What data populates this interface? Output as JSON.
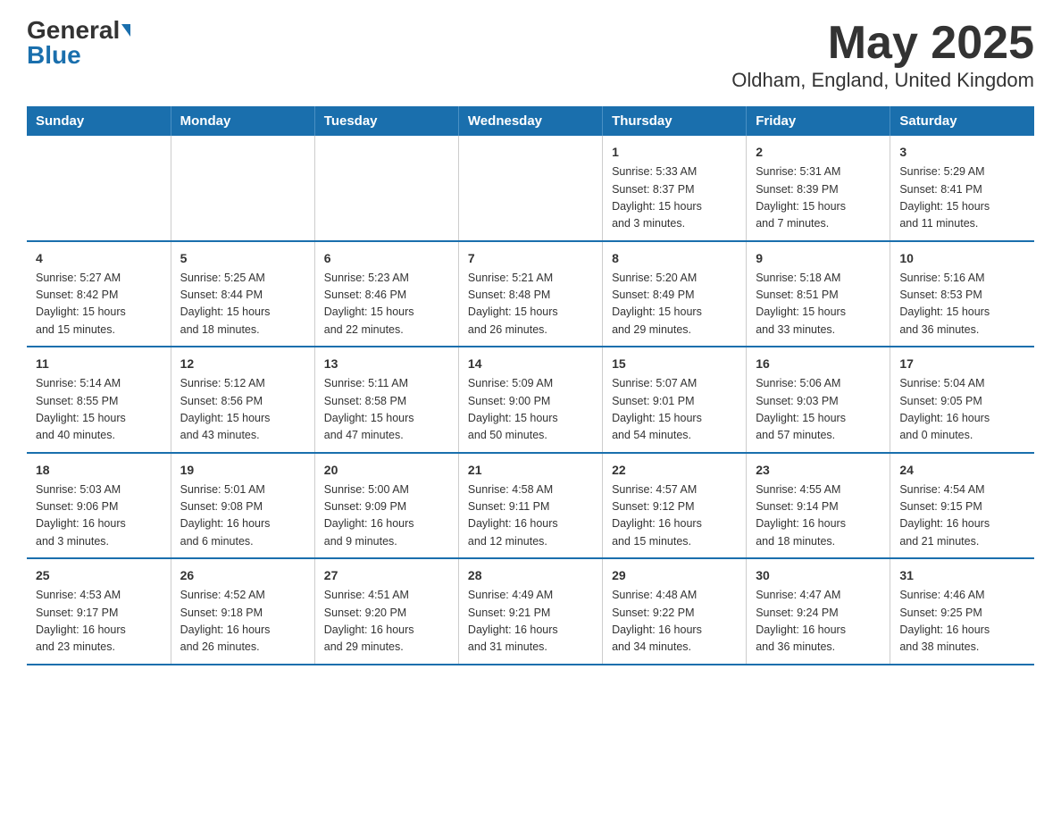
{
  "header": {
    "logo_general": "General",
    "logo_blue": "Blue",
    "title": "May 2025",
    "subtitle": "Oldham, England, United Kingdom"
  },
  "days_of_week": [
    "Sunday",
    "Monday",
    "Tuesday",
    "Wednesday",
    "Thursday",
    "Friday",
    "Saturday"
  ],
  "weeks": [
    [
      {
        "day": "",
        "info": ""
      },
      {
        "day": "",
        "info": ""
      },
      {
        "day": "",
        "info": ""
      },
      {
        "day": "",
        "info": ""
      },
      {
        "day": "1",
        "info": "Sunrise: 5:33 AM\nSunset: 8:37 PM\nDaylight: 15 hours\nand 3 minutes."
      },
      {
        "day": "2",
        "info": "Sunrise: 5:31 AM\nSunset: 8:39 PM\nDaylight: 15 hours\nand 7 minutes."
      },
      {
        "day": "3",
        "info": "Sunrise: 5:29 AM\nSunset: 8:41 PM\nDaylight: 15 hours\nand 11 minutes."
      }
    ],
    [
      {
        "day": "4",
        "info": "Sunrise: 5:27 AM\nSunset: 8:42 PM\nDaylight: 15 hours\nand 15 minutes."
      },
      {
        "day": "5",
        "info": "Sunrise: 5:25 AM\nSunset: 8:44 PM\nDaylight: 15 hours\nand 18 minutes."
      },
      {
        "day": "6",
        "info": "Sunrise: 5:23 AM\nSunset: 8:46 PM\nDaylight: 15 hours\nand 22 minutes."
      },
      {
        "day": "7",
        "info": "Sunrise: 5:21 AM\nSunset: 8:48 PM\nDaylight: 15 hours\nand 26 minutes."
      },
      {
        "day": "8",
        "info": "Sunrise: 5:20 AM\nSunset: 8:49 PM\nDaylight: 15 hours\nand 29 minutes."
      },
      {
        "day": "9",
        "info": "Sunrise: 5:18 AM\nSunset: 8:51 PM\nDaylight: 15 hours\nand 33 minutes."
      },
      {
        "day": "10",
        "info": "Sunrise: 5:16 AM\nSunset: 8:53 PM\nDaylight: 15 hours\nand 36 minutes."
      }
    ],
    [
      {
        "day": "11",
        "info": "Sunrise: 5:14 AM\nSunset: 8:55 PM\nDaylight: 15 hours\nand 40 minutes."
      },
      {
        "day": "12",
        "info": "Sunrise: 5:12 AM\nSunset: 8:56 PM\nDaylight: 15 hours\nand 43 minutes."
      },
      {
        "day": "13",
        "info": "Sunrise: 5:11 AM\nSunset: 8:58 PM\nDaylight: 15 hours\nand 47 minutes."
      },
      {
        "day": "14",
        "info": "Sunrise: 5:09 AM\nSunset: 9:00 PM\nDaylight: 15 hours\nand 50 minutes."
      },
      {
        "day": "15",
        "info": "Sunrise: 5:07 AM\nSunset: 9:01 PM\nDaylight: 15 hours\nand 54 minutes."
      },
      {
        "day": "16",
        "info": "Sunrise: 5:06 AM\nSunset: 9:03 PM\nDaylight: 15 hours\nand 57 minutes."
      },
      {
        "day": "17",
        "info": "Sunrise: 5:04 AM\nSunset: 9:05 PM\nDaylight: 16 hours\nand 0 minutes."
      }
    ],
    [
      {
        "day": "18",
        "info": "Sunrise: 5:03 AM\nSunset: 9:06 PM\nDaylight: 16 hours\nand 3 minutes."
      },
      {
        "day": "19",
        "info": "Sunrise: 5:01 AM\nSunset: 9:08 PM\nDaylight: 16 hours\nand 6 minutes."
      },
      {
        "day": "20",
        "info": "Sunrise: 5:00 AM\nSunset: 9:09 PM\nDaylight: 16 hours\nand 9 minutes."
      },
      {
        "day": "21",
        "info": "Sunrise: 4:58 AM\nSunset: 9:11 PM\nDaylight: 16 hours\nand 12 minutes."
      },
      {
        "day": "22",
        "info": "Sunrise: 4:57 AM\nSunset: 9:12 PM\nDaylight: 16 hours\nand 15 minutes."
      },
      {
        "day": "23",
        "info": "Sunrise: 4:55 AM\nSunset: 9:14 PM\nDaylight: 16 hours\nand 18 minutes."
      },
      {
        "day": "24",
        "info": "Sunrise: 4:54 AM\nSunset: 9:15 PM\nDaylight: 16 hours\nand 21 minutes."
      }
    ],
    [
      {
        "day": "25",
        "info": "Sunrise: 4:53 AM\nSunset: 9:17 PM\nDaylight: 16 hours\nand 23 minutes."
      },
      {
        "day": "26",
        "info": "Sunrise: 4:52 AM\nSunset: 9:18 PM\nDaylight: 16 hours\nand 26 minutes."
      },
      {
        "day": "27",
        "info": "Sunrise: 4:51 AM\nSunset: 9:20 PM\nDaylight: 16 hours\nand 29 minutes."
      },
      {
        "day": "28",
        "info": "Sunrise: 4:49 AM\nSunset: 9:21 PM\nDaylight: 16 hours\nand 31 minutes."
      },
      {
        "day": "29",
        "info": "Sunrise: 4:48 AM\nSunset: 9:22 PM\nDaylight: 16 hours\nand 34 minutes."
      },
      {
        "day": "30",
        "info": "Sunrise: 4:47 AM\nSunset: 9:24 PM\nDaylight: 16 hours\nand 36 minutes."
      },
      {
        "day": "31",
        "info": "Sunrise: 4:46 AM\nSunset: 9:25 PM\nDaylight: 16 hours\nand 38 minutes."
      }
    ]
  ]
}
